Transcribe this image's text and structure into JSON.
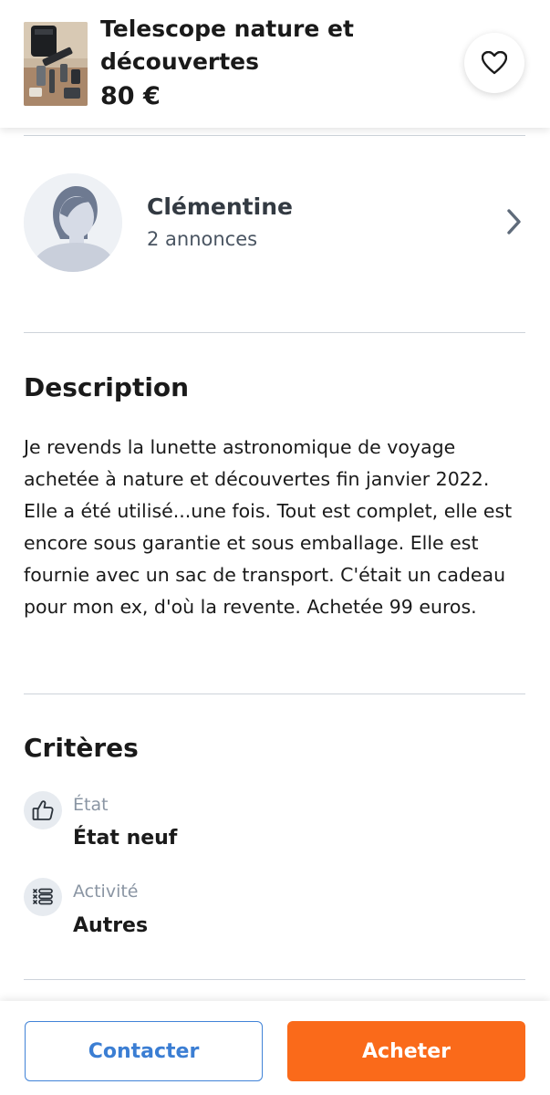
{
  "header": {
    "title": "Telescope nature et découvertes",
    "price": "80 €",
    "thumbnail_icon": "product-photo"
  },
  "seller": {
    "name": "Clémentine",
    "listings": "2 annonces"
  },
  "description": {
    "title": "Description",
    "text": "Je revends la lunette astronomique de voyage achetée à nature et découvertes fin janvier 2022. Elle a été utilisé...une fois. Tout est complet, elle est encore sous garantie et sous emballage. Elle est fournie avec un sac de transport. C'était un cadeau pour mon ex, d'où la revente. Achetée 99 euros."
  },
  "criteria": {
    "title": "Critères",
    "items": [
      {
        "label": "État",
        "value": "État neuf",
        "icon": "thumbs-up-icon"
      },
      {
        "label": "Activité",
        "value": "Autres",
        "icon": "list-icon"
      }
    ]
  },
  "actions": {
    "contact_label": "Contacter",
    "buy_label": "Acheter"
  },
  "colors": {
    "accent_orange": "#fa6a1a",
    "accent_blue": "#3b7ed3",
    "divider": "#cdd3da",
    "muted_text": "#8a95a3"
  }
}
